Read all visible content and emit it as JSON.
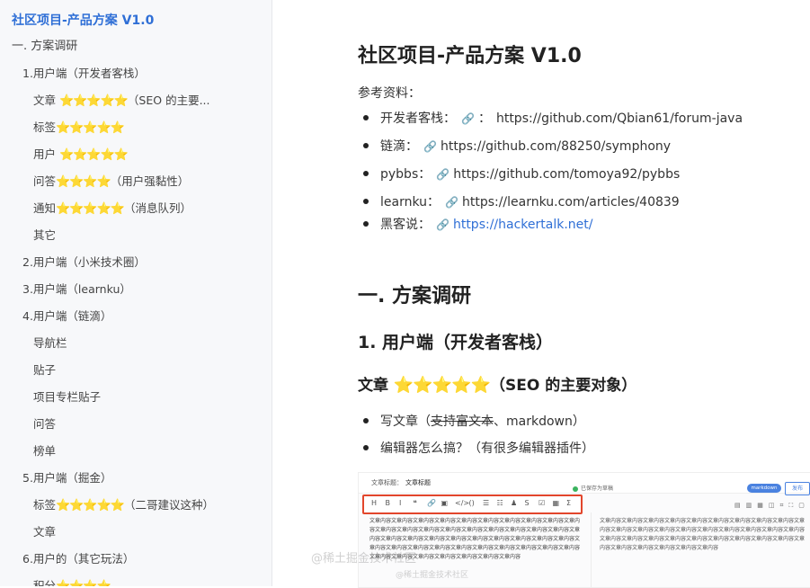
{
  "sidebar": {
    "title": "社区项目-产品方案 V1.0",
    "items": [
      {
        "text": "一. 方案调研",
        "level": 1,
        "stars": "",
        "suffix": ""
      },
      {
        "text": "1.用户端（开发者客栈）",
        "level": 2,
        "stars": "",
        "suffix": ""
      },
      {
        "text": "文章 ",
        "level": 3,
        "stars": "⭐⭐⭐⭐⭐",
        "suffix": "（SEO 的主要..."
      },
      {
        "text": "标签",
        "level": 3,
        "stars": "⭐⭐⭐⭐⭐",
        "suffix": ""
      },
      {
        "text": "用户 ",
        "level": 3,
        "stars": "⭐⭐⭐⭐⭐",
        "suffix": ""
      },
      {
        "text": "问答",
        "level": 3,
        "stars": "⭐⭐⭐⭐",
        "suffix": "（用户强黏性）"
      },
      {
        "text": "通知",
        "level": 3,
        "stars": "⭐⭐⭐⭐⭐",
        "suffix": "（消息队列）"
      },
      {
        "text": "其它",
        "level": 3,
        "stars": "",
        "suffix": ""
      },
      {
        "text": "2.用户端（小米技术圈）",
        "level": 2,
        "stars": "",
        "suffix": ""
      },
      {
        "text": "3.用户端（learnku）",
        "level": 2,
        "stars": "",
        "suffix": ""
      },
      {
        "text": "4.用户端（链滴）",
        "level": 2,
        "stars": "",
        "suffix": ""
      },
      {
        "text": "导航栏",
        "level": 3,
        "stars": "",
        "suffix": ""
      },
      {
        "text": "贴子",
        "level": 3,
        "stars": "",
        "suffix": ""
      },
      {
        "text": "项目专栏贴子",
        "level": 3,
        "stars": "",
        "suffix": ""
      },
      {
        "text": "问答",
        "level": 3,
        "stars": "",
        "suffix": ""
      },
      {
        "text": "榜单",
        "level": 3,
        "stars": "",
        "suffix": ""
      },
      {
        "text": "5.用户端（掘金）",
        "level": 2,
        "stars": "",
        "suffix": ""
      },
      {
        "text": "标签",
        "level": 3,
        "stars": "⭐⭐⭐⭐⭐",
        "suffix": "（二哥建议这种）"
      },
      {
        "text": "文章",
        "level": 3,
        "stars": "",
        "suffix": ""
      },
      {
        "text": "6.用户的（其它玩法）",
        "level": 2,
        "stars": "",
        "suffix": ""
      },
      {
        "text": "积分",
        "level": 3,
        "stars": "⭐⭐⭐⭐",
        "suffix": ""
      }
    ]
  },
  "doc": {
    "title": "社区项目-产品方案 V1.0",
    "ref_label": "参考资料：",
    "refs": [
      {
        "name": "开发者客栈：",
        "sep": "：",
        "url": "https://github.com/Qbian61/forum-java",
        "is_link": false
      },
      {
        "name": "链滴：",
        "sep": "",
        "url": "https://github.com/88250/symphony",
        "is_link": false
      },
      {
        "name": "pybbs：",
        "sep": "",
        "url": "https://github.com/tomoya92/pybbs",
        "is_link": false
      },
      {
        "name": "learnku：",
        "sep": "",
        "url": "https://learnku.com/articles/40839",
        "is_link": false
      },
      {
        "name": "黑客说：",
        "sep": "",
        "url": "https://hackertalk.net/",
        "is_link": true
      }
    ],
    "h1": "一. 方案调研",
    "h2": "1.  用户端（开发者客栈）",
    "h3_text": "文章 ",
    "h3_stars": "⭐⭐⭐⭐⭐",
    "h3_suffix": "（SEO 的主要对象）",
    "list": [
      {
        "pre": "写文章（",
        "strike": "支持富文本",
        "post": "、markdown）"
      },
      {
        "pre": "编辑器怎么搞？（有很多编辑器插件）",
        "strike": "",
        "post": ""
      }
    ]
  },
  "screenshot": {
    "title_label": "文章标题：",
    "title_value": "文章标题",
    "saved_text": "已保存为草稿",
    "mode_toggle": "markdown",
    "publish_label": "发布",
    "toolbar": [
      "H",
      "B",
      "I",
      "❝",
      "🔗",
      "▣",
      "</>",
      "()",
      "☰",
      "☷",
      "♟",
      "S",
      "☑",
      "▦",
      "Σ"
    ],
    "body_text": "文章内容文章内容文章内容文章内容文章内容文章内容文章内容文章内容文章内容文章内容文章内容文章内容文章内容文章内容文章内容文章内容文章内容文章内容文章内容文章内容文章内容文章内容文章内容文章内容文章内容文章内容文章内容文章内容文章内容文章内容文章内容文章内容文章内容文章内容文章内容文章内容文章内容文章内容文章内容文章内容文章内容文章内容文章内容文章内容文章内容文章内容",
    "preview_text": "文章内容文章内容文章内容文章内容文章内容文章内容文章内容文章内容文章内容文章内容文章内容文章内容文章内容文章内容文章内容文章内容文章内容文章内容文章内容文章内容文章内容文章内容文章内容文章内容文章内容文章内容文章内容文章内容文章内容文章内容文章内容文章内容文章内容文章内容"
  },
  "watermark": "@稀土掘金技术社区",
  "watermark_small": "@稀土掘金技术社区"
}
